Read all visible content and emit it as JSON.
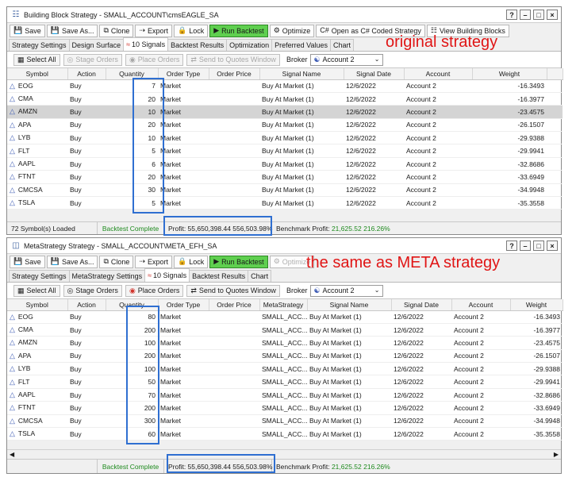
{
  "windows": [
    {
      "title": "Building Block Strategy - SMALL_ACCOUNT\\cmsEAGLE_SA",
      "title_icon": "building-blocks-icon",
      "toolbar": {
        "save": "Save",
        "save_as": "Save As...",
        "clone": "Clone",
        "export": "Export",
        "lock": "Lock",
        "run_backtest": "Run Backtest",
        "optimize": "Optimize",
        "open_csharp": "Open as C# Coded Strategy",
        "view_blocks": "View Building Blocks"
      },
      "tabs": [
        "Strategy Settings",
        "Design Surface",
        "10 Signals",
        "Backtest Results",
        "Optimization",
        "Preferred Values",
        "Chart"
      ],
      "active_tab": "10 Signals",
      "signals_bar": {
        "select_all": "Select All",
        "stage_orders": "Stage Orders",
        "place_orders": "Place Orders",
        "send_to_quotes": "Send to Quotes Window",
        "broker_label": "Broker",
        "broker_value": "Account 2"
      },
      "columns": [
        "Symbol",
        "Action",
        "Quantity",
        "Order Type",
        "Order Price",
        "Signal Name",
        "Signal Date",
        "Account",
        "Weight"
      ],
      "rows": [
        {
          "symbol": "EOG",
          "action": "Buy",
          "quantity": "7",
          "order_type": "Market",
          "order_price": "",
          "signal_name": "Buy At Market (1)",
          "signal_date": "12/6/2022",
          "account": "Account 2",
          "weight": "-16.3493"
        },
        {
          "symbol": "CMA",
          "action": "Buy",
          "quantity": "20",
          "order_type": "Market",
          "order_price": "",
          "signal_name": "Buy At Market (1)",
          "signal_date": "12/6/2022",
          "account": "Account 2",
          "weight": "-16.3977"
        },
        {
          "symbol": "AMZN",
          "action": "Buy",
          "quantity": "10",
          "order_type": "Market",
          "order_price": "",
          "signal_name": "Buy At Market (1)",
          "signal_date": "12/6/2022",
          "account": "Account 2",
          "weight": "-23.4575"
        },
        {
          "symbol": "APA",
          "action": "Buy",
          "quantity": "20",
          "order_type": "Market",
          "order_price": "",
          "signal_name": "Buy At Market (1)",
          "signal_date": "12/6/2022",
          "account": "Account 2",
          "weight": "-26.1507"
        },
        {
          "symbol": "LYB",
          "action": "Buy",
          "quantity": "10",
          "order_type": "Market",
          "order_price": "",
          "signal_name": "Buy At Market (1)",
          "signal_date": "12/6/2022",
          "account": "Account 2",
          "weight": "-29.9388"
        },
        {
          "symbol": "FLT",
          "action": "Buy",
          "quantity": "5",
          "order_type": "Market",
          "order_price": "",
          "signal_name": "Buy At Market (1)",
          "signal_date": "12/6/2022",
          "account": "Account 2",
          "weight": "-29.9941"
        },
        {
          "symbol": "AAPL",
          "action": "Buy",
          "quantity": "6",
          "order_type": "Market",
          "order_price": "",
          "signal_name": "Buy At Market (1)",
          "signal_date": "12/6/2022",
          "account": "Account 2",
          "weight": "-32.8686"
        },
        {
          "symbol": "FTNT",
          "action": "Buy",
          "quantity": "20",
          "order_type": "Market",
          "order_price": "",
          "signal_name": "Buy At Market (1)",
          "signal_date": "12/6/2022",
          "account": "Account 2",
          "weight": "-33.6949"
        },
        {
          "symbol": "CMCSA",
          "action": "Buy",
          "quantity": "30",
          "order_type": "Market",
          "order_price": "",
          "signal_name": "Buy At Market (1)",
          "signal_date": "12/6/2022",
          "account": "Account 2",
          "weight": "-34.9948"
        },
        {
          "symbol": "TSLA",
          "action": "Buy",
          "quantity": "5",
          "order_type": "Market",
          "order_price": "",
          "signal_name": "Buy At Market (1)",
          "signal_date": "12/6/2022",
          "account": "Account 2",
          "weight": "-35.3558"
        }
      ],
      "status": {
        "symbols_loaded": "72 Symbol(s) Loaded",
        "backtest": "Backtest Complete",
        "profit": "Profit: 55,650,398.44 556,503.98%",
        "benchmark_label": "Benchmark Profit:",
        "benchmark_value": "21,625.52 216.26%"
      },
      "annotation": "original strategy"
    },
    {
      "title": "MetaStrategy Strategy - SMALL_ACCOUNT\\META_EFH_SA",
      "title_icon": "meta-strategy-icon",
      "toolbar": {
        "save": "Save",
        "save_as": "Save As...",
        "clone": "Clone",
        "export": "Export",
        "lock": "Lock",
        "run_backtest": "Run Backtest",
        "optimize": "Optimize"
      },
      "tabs": [
        "Strategy Settings",
        "MetaStrategy Settings",
        "10 Signals",
        "Backtest Results",
        "Chart"
      ],
      "active_tab": "10 Signals",
      "signals_bar": {
        "select_all": "Select All",
        "stage_orders": "Stage Orders",
        "place_orders": "Place Orders",
        "send_to_quotes": "Send to Quotes Window",
        "broker_label": "Broker",
        "broker_value": "Account 2"
      },
      "columns": [
        "Symbol",
        "Action",
        "Quantity",
        "Order Type",
        "Order Price",
        "MetaStrategy",
        "Signal Name",
        "Signal Date",
        "Account",
        "Weight"
      ],
      "rows": [
        {
          "symbol": "EOG",
          "action": "Buy",
          "quantity": "80",
          "order_type": "Market",
          "order_price": "",
          "meta": "SMALL_ACC...",
          "signal_name": "Buy At Market (1)",
          "signal_date": "12/6/2022",
          "account": "Account 2",
          "weight": "-16.3493"
        },
        {
          "symbol": "CMA",
          "action": "Buy",
          "quantity": "200",
          "order_type": "Market",
          "order_price": "",
          "meta": "SMALL_ACC...",
          "signal_name": "Buy At Market (1)",
          "signal_date": "12/6/2022",
          "account": "Account 2",
          "weight": "-16.3977"
        },
        {
          "symbol": "AMZN",
          "action": "Buy",
          "quantity": "100",
          "order_type": "Market",
          "order_price": "",
          "meta": "SMALL_ACC...",
          "signal_name": "Buy At Market (1)",
          "signal_date": "12/6/2022",
          "account": "Account 2",
          "weight": "-23.4575"
        },
        {
          "symbol": "APA",
          "action": "Buy",
          "quantity": "200",
          "order_type": "Market",
          "order_price": "",
          "meta": "SMALL_ACC...",
          "signal_name": "Buy At Market (1)",
          "signal_date": "12/6/2022",
          "account": "Account 2",
          "weight": "-26.1507"
        },
        {
          "symbol": "LYB",
          "action": "Buy",
          "quantity": "100",
          "order_type": "Market",
          "order_price": "",
          "meta": "SMALL_ACC...",
          "signal_name": "Buy At Market (1)",
          "signal_date": "12/6/2022",
          "account": "Account 2",
          "weight": "-29.9388"
        },
        {
          "symbol": "FLT",
          "action": "Buy",
          "quantity": "50",
          "order_type": "Market",
          "order_price": "",
          "meta": "SMALL_ACC...",
          "signal_name": "Buy At Market (1)",
          "signal_date": "12/6/2022",
          "account": "Account 2",
          "weight": "-29.9941"
        },
        {
          "symbol": "AAPL",
          "action": "Buy",
          "quantity": "70",
          "order_type": "Market",
          "order_price": "",
          "meta": "SMALL_ACC...",
          "signal_name": "Buy At Market (1)",
          "signal_date": "12/6/2022",
          "account": "Account 2",
          "weight": "-32.8686"
        },
        {
          "symbol": "FTNT",
          "action": "Buy",
          "quantity": "200",
          "order_type": "Market",
          "order_price": "",
          "meta": "SMALL_ACC...",
          "signal_name": "Buy At Market (1)",
          "signal_date": "12/6/2022",
          "account": "Account 2",
          "weight": "-33.6949"
        },
        {
          "symbol": "CMCSA",
          "action": "Buy",
          "quantity": "300",
          "order_type": "Market",
          "order_price": "",
          "meta": "SMALL_ACC...",
          "signal_name": "Buy At Market (1)",
          "signal_date": "12/6/2022",
          "account": "Account 2",
          "weight": "-34.9948"
        },
        {
          "symbol": "TSLA",
          "action": "Buy",
          "quantity": "60",
          "order_type": "Market",
          "order_price": "",
          "meta": "SMALL_ACC...",
          "signal_name": "Buy At Market (1)",
          "signal_date": "12/6/2022",
          "account": "Account 2",
          "weight": "-35.3558"
        }
      ],
      "status": {
        "backtest": "Backtest Complete",
        "profit": "Profit: 55,650,398.44 556,503.98%",
        "benchmark_label": "Benchmark Profit:",
        "benchmark_value": "21,625.52 216.26%"
      },
      "annotation": "the same as META strategy"
    }
  ],
  "colors": {
    "annotation": "#e01515",
    "highlight_box": "#2f6fd1",
    "run_button": "#5fcf4f",
    "status_green": "#1e8a1e",
    "selected_row": "#d4d4d4"
  }
}
